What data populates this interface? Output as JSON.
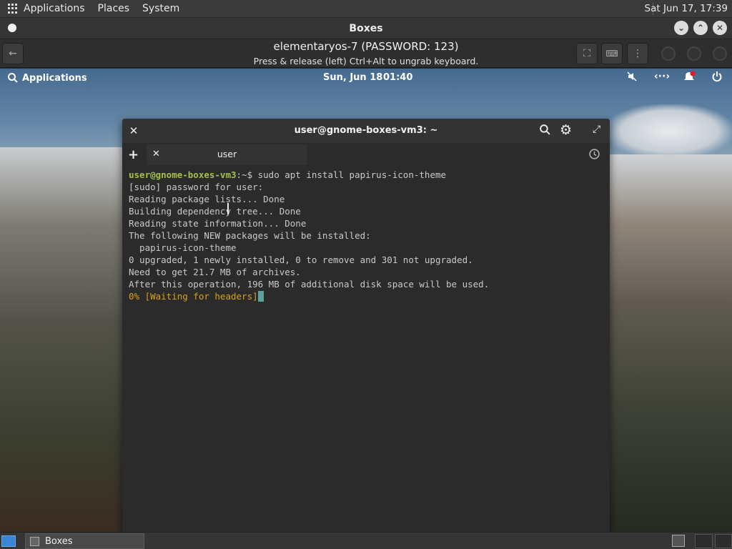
{
  "host_panel": {
    "menus": [
      "Applications",
      "Places",
      "System"
    ],
    "clock": "Sat Jun 17, 17:39"
  },
  "boxes_window": {
    "title": "Boxes",
    "vm_name": "elementaryos-7 (PASSWORD: 123)",
    "ungrab_hint": "Press & release (left) Ctrl+Alt to ungrab keyboard."
  },
  "guest_panel": {
    "applications_label": "Applications",
    "date": "Sun, Jun 18",
    "time": "01:40",
    "icons": [
      "search-icon",
      "mute-icon",
      "network-icon",
      "notification-icon",
      "power-icon"
    ]
  },
  "terminal": {
    "title": "user@gnome-boxes-vm3: ~",
    "tab_label": "user",
    "prompt_user": "user@gnome-boxes-vm3",
    "prompt_rest": ":~$",
    "command": " sudo apt install papirus-icon-theme",
    "output_lines": [
      "[sudo] password for user:",
      "Reading package lists... Done",
      "Building dependency tree... Done",
      "Reading state information... Done",
      "The following NEW packages will be installed:",
      "  papirus-icon-theme",
      "0 upgraded, 1 newly installed, 0 to remove and 301 not upgraded.",
      "Need to get 21.7 MB of archives.",
      "After this operation, 196 MB of additional disk space will be used."
    ],
    "progress_line": "0% [Waiting for headers]"
  },
  "taskbar": {
    "task_label": "Boxes"
  },
  "colors": {
    "prompt_user": "#a1c149",
    "progress": "#d8a31a",
    "cursor": "#5fa1a0"
  }
}
